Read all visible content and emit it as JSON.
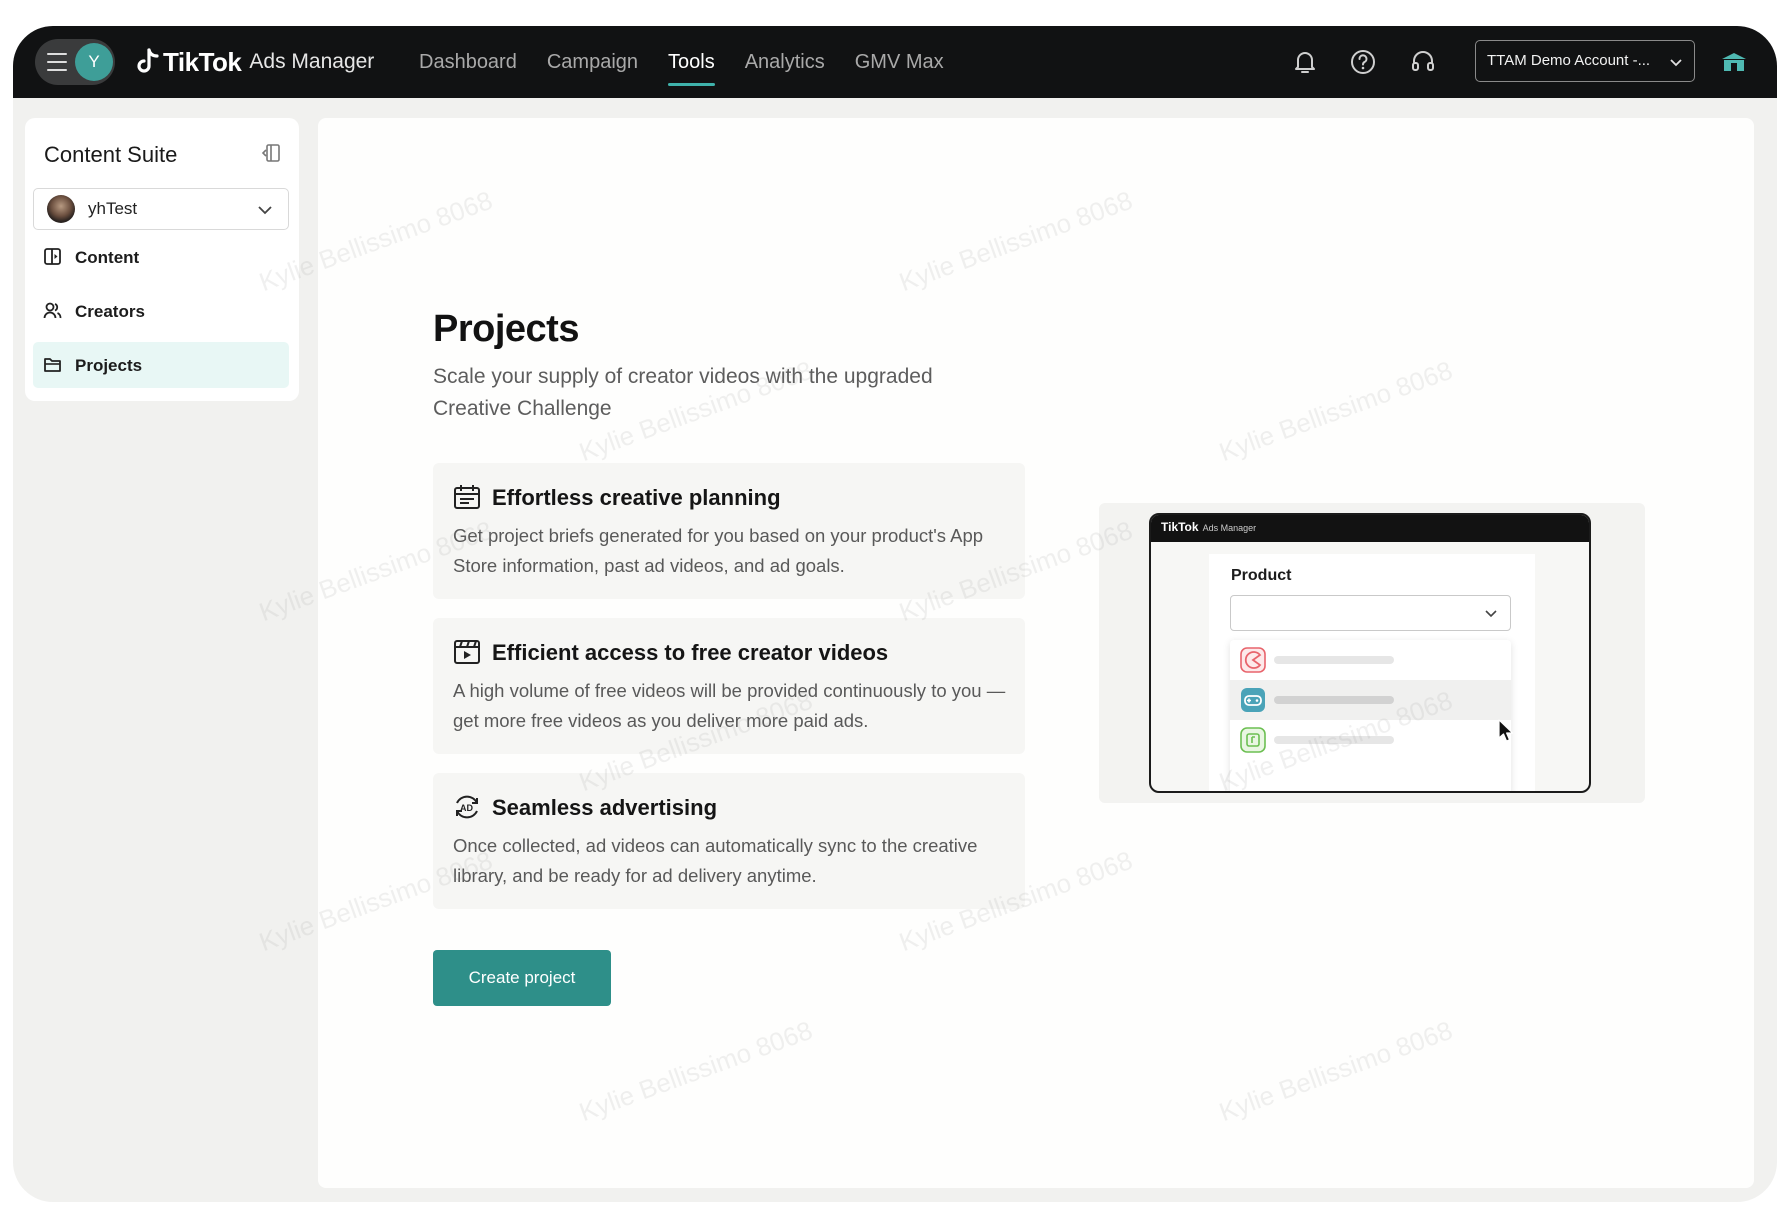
{
  "topbar": {
    "avatar_letter": "Y",
    "brand_name": "TikTok",
    "brand_product": "Ads Manager",
    "nav": [
      {
        "label": "Dashboard",
        "active": false
      },
      {
        "label": "Campaign",
        "active": false
      },
      {
        "label": "Tools",
        "active": true
      },
      {
        "label": "Analytics",
        "active": false
      },
      {
        "label": "GMV Max",
        "active": false
      }
    ],
    "account_label": "TTAM Demo Account -..."
  },
  "sidebar": {
    "title": "Content Suite",
    "account_name": "yhTest",
    "items": [
      {
        "label": "Content",
        "icon": "content-icon",
        "active": false
      },
      {
        "label": "Creators",
        "icon": "creators-icon",
        "active": false
      },
      {
        "label": "Projects",
        "icon": "folder-icon",
        "active": true
      }
    ]
  },
  "main": {
    "title": "Projects",
    "subtitle": "Scale your supply of creator videos with the upgraded Creative Challenge",
    "features": [
      {
        "icon": "calendar-icon",
        "title": "Effortless creative planning",
        "text": "Get project briefs generated for you based on your product's App Store information, past ad videos, and ad goals."
      },
      {
        "icon": "video-icon",
        "title": "Efficient access to free creator videos",
        "text": "A high volume of free videos will be provided continuously to you — get more free videos as you deliver more paid ads."
      },
      {
        "icon": "ad-sync-icon",
        "title": "Seamless advertising",
        "text": "Once collected, ad videos can automatically sync to the creative library, and be ready for ad delivery anytime."
      }
    ],
    "cta_label": "Create project"
  },
  "preview": {
    "brand": "TikTok",
    "brand_product": "Ads Manager",
    "field_label": "Product"
  },
  "watermark": "Kylie Bellissimo 8068",
  "colors": {
    "accent": "#2e8f89",
    "accent_light": "#e8f7f5",
    "topbar_bg": "#111213",
    "nav_underline": "#3fb2ab"
  }
}
